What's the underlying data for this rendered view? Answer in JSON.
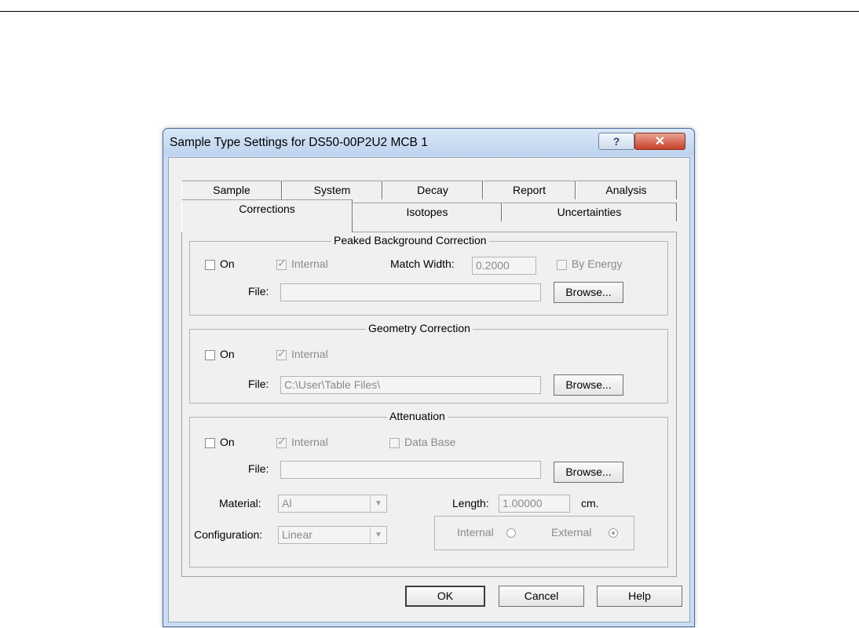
{
  "window": {
    "title": "Sample Type Settings for DS50-00P2U2 MCB 1"
  },
  "titlebar_icons": {
    "help": "help-icon",
    "close": "close-icon"
  },
  "tabs_row1": [
    "Sample",
    "System",
    "Decay",
    "Report",
    "Analysis"
  ],
  "tabs_row2": [
    "Corrections",
    "Isotopes",
    "Uncertainties"
  ],
  "active_tab": "Corrections",
  "peaked": {
    "title": "Peaked Background Correction",
    "on_label": "On",
    "on_checked": false,
    "internal_label": "Internal",
    "internal_checked": true,
    "match_width_label": "Match Width:",
    "match_width_value": "0.2000",
    "by_energy_label": "By Energy",
    "by_energy_checked": false,
    "file_label": "File:",
    "file_value": "",
    "browse_label": "Browse..."
  },
  "geometry": {
    "title": "Geometry Correction",
    "on_label": "On",
    "on_checked": false,
    "internal_label": "Internal",
    "internal_checked": true,
    "file_label": "File:",
    "file_value": "C:\\User\\Table Files\\",
    "browse_label": "Browse..."
  },
  "attenuation": {
    "title": "Attenuation",
    "on_label": "On",
    "on_checked": false,
    "internal_label": "Internal",
    "internal_checked": true,
    "database_label": "Data Base",
    "database_checked": false,
    "file_label": "File:",
    "file_value": "",
    "browse_label": "Browse...",
    "material_label": "Material:",
    "material_value": "Al",
    "length_label": "Length:",
    "length_value": "1.00000",
    "length_unit": "cm.",
    "configuration_label": "Configuration:",
    "configuration_value": "Linear",
    "radio_internal_label": "Internal",
    "radio_external_label": "External",
    "radio_selected": "External"
  },
  "buttons": {
    "ok": "OK",
    "cancel": "Cancel",
    "help": "Help"
  }
}
